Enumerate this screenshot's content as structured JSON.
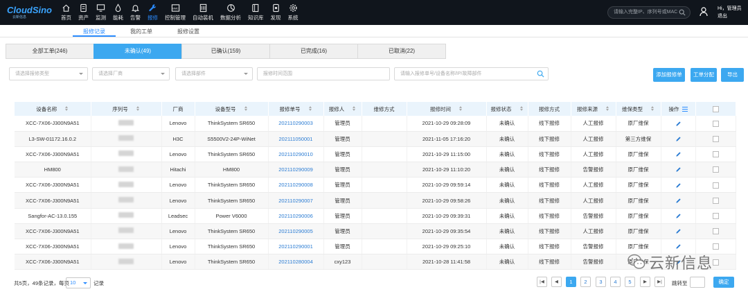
{
  "app": {
    "logo": "CloudSino",
    "logo_sub": "云新信息",
    "nav": [
      {
        "label": "首页",
        "icon": "home-icon"
      },
      {
        "label": "资产",
        "icon": "asset-icon"
      },
      {
        "label": "监测",
        "icon": "monitor-icon"
      },
      {
        "label": "能耗",
        "icon": "energy-icon"
      },
      {
        "label": "告警",
        "icon": "bell-icon"
      },
      {
        "label": "报修",
        "icon": "wrench-icon",
        "active": true
      },
      {
        "label": "控制管理",
        "icon": "bmc-icon"
      },
      {
        "label": "自动装机",
        "icon": "server-icon"
      },
      {
        "label": "数据分析",
        "icon": "pie-chart-icon"
      },
      {
        "label": "知识库",
        "icon": "book-icon"
      },
      {
        "label": "发现",
        "icon": "discover-icon"
      },
      {
        "label": "系统",
        "icon": "gear-icon"
      }
    ],
    "search_placeholder": "请输入完整IP、序列号或MAC",
    "user_greeting": "Hi，管理员",
    "logout": "退出"
  },
  "subtabs": [
    "报修记录",
    "我的工单",
    "报修设置"
  ],
  "status_tabs": [
    "全部工单(246)",
    "未确认(49)",
    "已确认(159)",
    "已完成(16)",
    "已取消(22)"
  ],
  "filters": {
    "type": "请选择报修类型",
    "vendor": "请选择厂商",
    "part": "请选择部件",
    "time": "报修时间范围",
    "keyword": "请输入报修单号/设备名称/IP/故障部件"
  },
  "buttons": {
    "add": "添加报修单",
    "assign": "工单分配",
    "export": "导出"
  },
  "columns": [
    "设备名称",
    "序列号",
    "厂商",
    "设备型号",
    "报修单号",
    "报修人",
    "维修方式",
    "报修时间",
    "报修状态",
    "报修方式",
    "报修来源",
    "维保类型",
    "操作"
  ],
  "rows": [
    {
      "name": "XCC-7X06-J300N9A51",
      "vendor": "Lenovo",
      "model": "ThinkSystem SR650",
      "ticket": "202110290003",
      "reporter": "管理员",
      "repair_method": "",
      "time": "2021-10-29 09:28:09",
      "status": "未确认",
      "mode": "线下报修",
      "source": "人工报修",
      "warranty": "原厂维保"
    },
    {
      "name": "L3-SW-01172.16.0.2",
      "vendor": "H3C",
      "model": "S5500V2-24P-WiNet",
      "ticket": "202111050001",
      "reporter": "管理员",
      "repair_method": "",
      "time": "2021-11-05 17:16:20",
      "status": "未确认",
      "mode": "线下报修",
      "source": "人工报修",
      "warranty": "第三方维保"
    },
    {
      "name": "XCC-7X06-J300N9A51",
      "vendor": "Lenovo",
      "model": "ThinkSystem SR650",
      "ticket": "202110290010",
      "reporter": "管理员",
      "repair_method": "",
      "time": "2021-10-29 11:15:00",
      "status": "未确认",
      "mode": "线下报修",
      "source": "人工报修",
      "warranty": "原厂维保"
    },
    {
      "name": "HM800",
      "vendor": "Hitachi",
      "model": "HM800",
      "ticket": "202110290009",
      "reporter": "管理员",
      "repair_method": "",
      "time": "2021-10-29 11:10:20",
      "status": "未确认",
      "mode": "线下报修",
      "source": "告警报修",
      "warranty": "原厂维保"
    },
    {
      "name": "XCC-7X06-J300N9A51",
      "vendor": "Lenovo",
      "model": "ThinkSystem SR650",
      "ticket": "202110290008",
      "reporter": "管理员",
      "repair_method": "",
      "time": "2021-10-29 09:59:14",
      "status": "未确认",
      "mode": "线下报修",
      "source": "人工报修",
      "warranty": "原厂维保"
    },
    {
      "name": "XCC-7X06-J300N9A51",
      "vendor": "Lenovo",
      "model": "ThinkSystem SR650",
      "ticket": "202110290007",
      "reporter": "管理员",
      "repair_method": "",
      "time": "2021-10-29 09:58:26",
      "status": "未确认",
      "mode": "线下报修",
      "source": "人工报修",
      "warranty": "原厂维保"
    },
    {
      "name": "Sangfor-AC-13.0.155",
      "vendor": "Leadsec",
      "model": "Power V6000",
      "ticket": "202110290006",
      "reporter": "管理员",
      "repair_method": "",
      "time": "2021-10-29 09:39:31",
      "status": "未确认",
      "mode": "线下报修",
      "source": "告警报修",
      "warranty": "原厂维保"
    },
    {
      "name": "XCC-7X06-J300N9A51",
      "vendor": "Lenovo",
      "model": "ThinkSystem SR650",
      "ticket": "202110290005",
      "reporter": "管理员",
      "repair_method": "",
      "time": "2021-10-29 09:35:54",
      "status": "未确认",
      "mode": "线下报修",
      "source": "人工报修",
      "warranty": "原厂维保"
    },
    {
      "name": "XCC-7X06-J300N9A51",
      "vendor": "Lenovo",
      "model": "ThinkSystem SR650",
      "ticket": "202110290001",
      "reporter": "管理员",
      "repair_method": "",
      "time": "2021-10-29 09:25:10",
      "status": "未确认",
      "mode": "线下报修",
      "source": "告警报修",
      "warranty": "原厂维保"
    },
    {
      "name": "XCC-7X06-J300N9A51",
      "vendor": "Lenovo",
      "model": "ThinkSystem SR650",
      "ticket": "202110280004",
      "reporter": "cxy123",
      "repair_method": "",
      "time": "2021-10-28 11:41:58",
      "status": "未确认",
      "mode": "线下报修",
      "source": "告警报修",
      "warranty": "原厂维保"
    }
  ],
  "footer": {
    "summary": "共5页，49条记录，每页",
    "per_page": "10",
    "per_page_label": "记录",
    "pages": [
      "1",
      "2",
      "3",
      "4",
      "5"
    ],
    "jump_label": "跳转至",
    "confirm": "确定"
  },
  "watermark": "云新信息",
  "colors": {
    "accent": "#3ca8f0",
    "link": "#2b7cd3",
    "topbar": "#10151c"
  }
}
